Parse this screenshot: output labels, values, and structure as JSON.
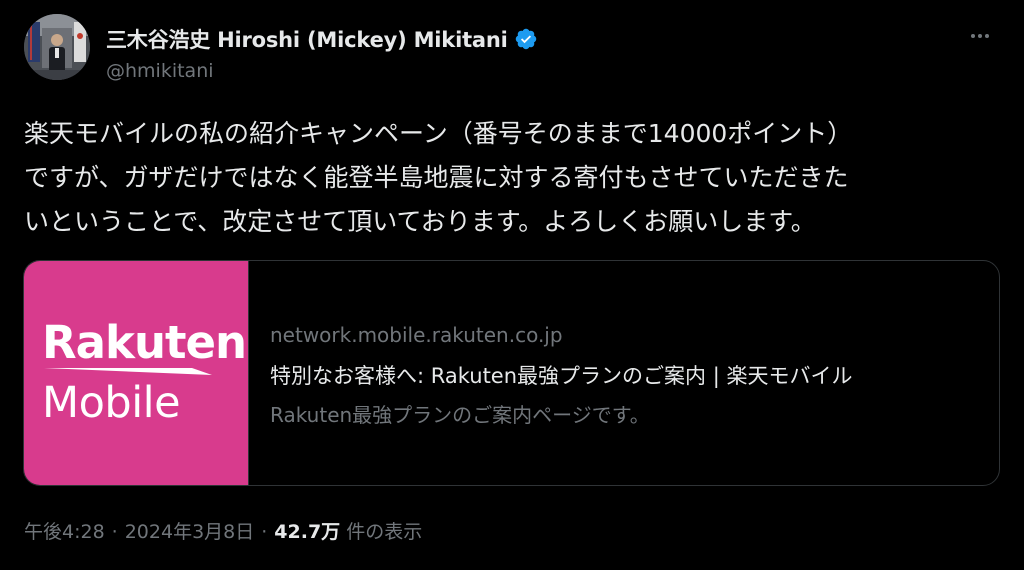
{
  "author": {
    "display_name": "三木谷浩史 Hiroshi (Mickey) Mikitani",
    "handle": "@hmikitani",
    "verified_icon": "verified-badge-icon",
    "verified_color": "#1d9bf0"
  },
  "tweet": {
    "lines": [
      "楽天モバイルの私の紹介キャンペーン（番号そのままで14000ポイント）",
      "ですが、ガザだけではなく能登半島地震に対する寄付もさせていただきた",
      "いということで、改定させて頂いております。よろしくお願いします。"
    ]
  },
  "card": {
    "thumb_line1": "Rakuten",
    "thumb_line2": "Mobile",
    "thumb_color": "#d83b8d",
    "domain": "network.mobile.rakuten.co.jp",
    "title": "特別なお客様へ: Rakuten最強プランのご案内 | 楽天モバイル",
    "description": "Rakuten最強プランのご案内ページです。"
  },
  "meta": {
    "time": "午後4:28",
    "separator": "·",
    "date": "2024年3月8日",
    "views_count": "42.7万",
    "views_label": "件の表示"
  },
  "colors": {
    "background": "#000000",
    "text_primary": "#e7e9ea",
    "text_secondary": "#71767b",
    "border": "#2f3336"
  }
}
